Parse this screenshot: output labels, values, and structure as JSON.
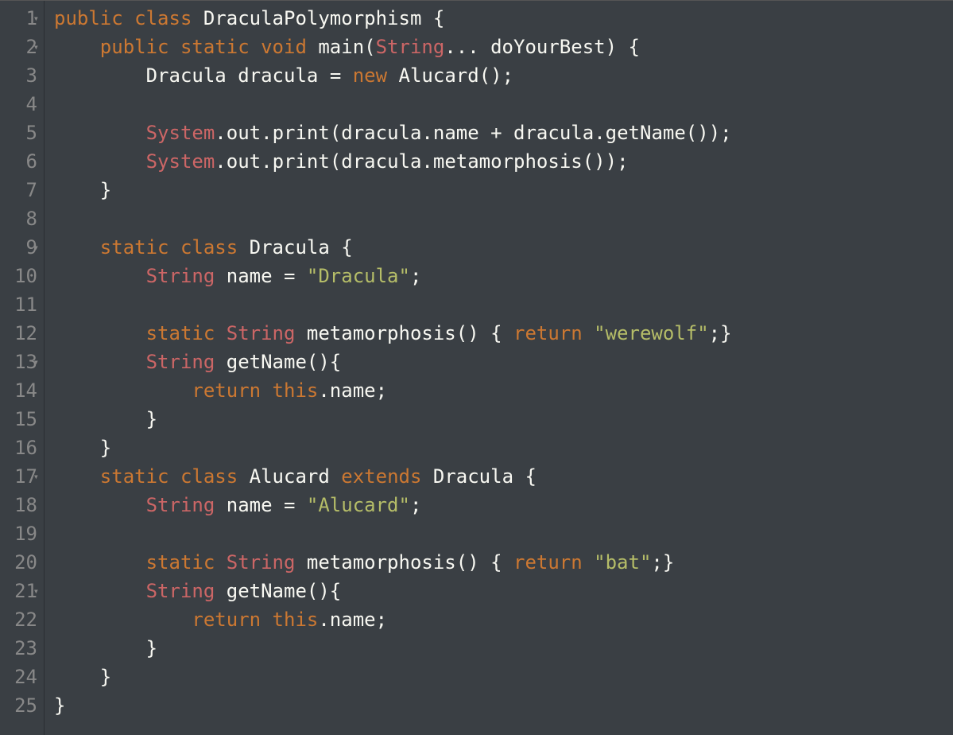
{
  "lineCount": 25,
  "foldLines": [
    1,
    2,
    9,
    13,
    17,
    21
  ],
  "code": {
    "l1": [
      {
        "t": "public",
        "c": "tok-keyword"
      },
      {
        "t": " ",
        "c": ""
      },
      {
        "t": "class",
        "c": "tok-keyword"
      },
      {
        "t": " ",
        "c": ""
      },
      {
        "t": "DraculaPolymorphism",
        "c": "tok-class"
      },
      {
        "t": " {",
        "c": "tok-punct"
      }
    ],
    "l2": [
      {
        "t": "    ",
        "c": ""
      },
      {
        "t": "public",
        "c": "tok-keyword"
      },
      {
        "t": " ",
        "c": ""
      },
      {
        "t": "static",
        "c": "tok-keyword"
      },
      {
        "t": " ",
        "c": ""
      },
      {
        "t": "void",
        "c": "tok-keyword"
      },
      {
        "t": " ",
        "c": ""
      },
      {
        "t": "main",
        "c": "tok-method"
      },
      {
        "t": "(",
        "c": "tok-punct"
      },
      {
        "t": "String",
        "c": "tok-type"
      },
      {
        "t": "... ",
        "c": "tok-punct"
      },
      {
        "t": "doYourBest",
        "c": "tok-param"
      },
      {
        "t": ") {",
        "c": "tok-punct"
      }
    ],
    "l3": [
      {
        "t": "        ",
        "c": ""
      },
      {
        "t": "Dracula",
        "c": "tok-class"
      },
      {
        "t": " ",
        "c": ""
      },
      {
        "t": "dracula",
        "c": "tok-field"
      },
      {
        "t": " ",
        "c": ""
      },
      {
        "t": "=",
        "c": "tok-op"
      },
      {
        "t": " ",
        "c": ""
      },
      {
        "t": "new",
        "c": "tok-keyword"
      },
      {
        "t": " ",
        "c": ""
      },
      {
        "t": "Alucard",
        "c": "tok-class"
      },
      {
        "t": "();",
        "c": "tok-punct"
      }
    ],
    "l4": [],
    "l5": [
      {
        "t": "        ",
        "c": ""
      },
      {
        "t": "System",
        "c": "tok-type"
      },
      {
        "t": ".",
        "c": "tok-punct"
      },
      {
        "t": "out",
        "c": "tok-field"
      },
      {
        "t": ".",
        "c": "tok-punct"
      },
      {
        "t": "print",
        "c": "tok-method"
      },
      {
        "t": "(",
        "c": "tok-punct"
      },
      {
        "t": "dracula",
        "c": "tok-field"
      },
      {
        "t": ".",
        "c": "tok-punct"
      },
      {
        "t": "name",
        "c": "tok-field"
      },
      {
        "t": " ",
        "c": ""
      },
      {
        "t": "+",
        "c": "tok-op"
      },
      {
        "t": " ",
        "c": ""
      },
      {
        "t": "dracula",
        "c": "tok-field"
      },
      {
        "t": ".",
        "c": "tok-punct"
      },
      {
        "t": "getName",
        "c": "tok-method"
      },
      {
        "t": "());",
        "c": "tok-punct"
      }
    ],
    "l6": [
      {
        "t": "        ",
        "c": ""
      },
      {
        "t": "System",
        "c": "tok-type"
      },
      {
        "t": ".",
        "c": "tok-punct"
      },
      {
        "t": "out",
        "c": "tok-field"
      },
      {
        "t": ".",
        "c": "tok-punct"
      },
      {
        "t": "print",
        "c": "tok-method"
      },
      {
        "t": "(",
        "c": "tok-punct"
      },
      {
        "t": "dracula",
        "c": "tok-field"
      },
      {
        "t": ".",
        "c": "tok-punct"
      },
      {
        "t": "metamorphosis",
        "c": "tok-method"
      },
      {
        "t": "());",
        "c": "tok-punct"
      }
    ],
    "l7": [
      {
        "t": "    }",
        "c": "tok-punct"
      }
    ],
    "l8": [],
    "l9": [
      {
        "t": "    ",
        "c": ""
      },
      {
        "t": "static",
        "c": "tok-keyword"
      },
      {
        "t": " ",
        "c": ""
      },
      {
        "t": "class",
        "c": "tok-keyword"
      },
      {
        "t": " ",
        "c": ""
      },
      {
        "t": "Dracula",
        "c": "tok-class"
      },
      {
        "t": " {",
        "c": "tok-punct"
      }
    ],
    "l10": [
      {
        "t": "        ",
        "c": ""
      },
      {
        "t": "String",
        "c": "tok-type"
      },
      {
        "t": " ",
        "c": ""
      },
      {
        "t": "name",
        "c": "tok-field"
      },
      {
        "t": " ",
        "c": ""
      },
      {
        "t": "=",
        "c": "tok-op"
      },
      {
        "t": " ",
        "c": ""
      },
      {
        "t": "\"Dracula\"",
        "c": "tok-string"
      },
      {
        "t": ";",
        "c": "tok-punct"
      }
    ],
    "l11": [],
    "l12": [
      {
        "t": "        ",
        "c": ""
      },
      {
        "t": "static",
        "c": "tok-keyword"
      },
      {
        "t": " ",
        "c": ""
      },
      {
        "t": "String",
        "c": "tok-type"
      },
      {
        "t": " ",
        "c": ""
      },
      {
        "t": "metamorphosis",
        "c": "tok-method"
      },
      {
        "t": "() { ",
        "c": "tok-punct"
      },
      {
        "t": "return",
        "c": "tok-keyword"
      },
      {
        "t": " ",
        "c": ""
      },
      {
        "t": "\"werewolf\"",
        "c": "tok-string"
      },
      {
        "t": ";}",
        "c": "tok-punct"
      }
    ],
    "l13": [
      {
        "t": "        ",
        "c": ""
      },
      {
        "t": "String",
        "c": "tok-type"
      },
      {
        "t": " ",
        "c": ""
      },
      {
        "t": "getName",
        "c": "tok-method"
      },
      {
        "t": "(){",
        "c": "tok-punct"
      }
    ],
    "l14": [
      {
        "t": "            ",
        "c": ""
      },
      {
        "t": "return",
        "c": "tok-keyword"
      },
      {
        "t": " ",
        "c": ""
      },
      {
        "t": "this",
        "c": "tok-this"
      },
      {
        "t": ".",
        "c": "tok-punct"
      },
      {
        "t": "name",
        "c": "tok-field"
      },
      {
        "t": ";",
        "c": "tok-punct"
      }
    ],
    "l15": [
      {
        "t": "        }",
        "c": "tok-punct"
      }
    ],
    "l16": [
      {
        "t": "    }",
        "c": "tok-punct"
      }
    ],
    "l17": [
      {
        "t": "    ",
        "c": ""
      },
      {
        "t": "static",
        "c": "tok-keyword"
      },
      {
        "t": " ",
        "c": ""
      },
      {
        "t": "class",
        "c": "tok-keyword"
      },
      {
        "t": " ",
        "c": ""
      },
      {
        "t": "Alucard",
        "c": "tok-class"
      },
      {
        "t": " ",
        "c": ""
      },
      {
        "t": "extends",
        "c": "tok-keyword"
      },
      {
        "t": " ",
        "c": ""
      },
      {
        "t": "Dracula",
        "c": "tok-class"
      },
      {
        "t": " {",
        "c": "tok-punct"
      }
    ],
    "l18": [
      {
        "t": "        ",
        "c": ""
      },
      {
        "t": "String",
        "c": "tok-type"
      },
      {
        "t": " ",
        "c": ""
      },
      {
        "t": "name",
        "c": "tok-field"
      },
      {
        "t": " ",
        "c": ""
      },
      {
        "t": "=",
        "c": "tok-op"
      },
      {
        "t": " ",
        "c": ""
      },
      {
        "t": "\"Alucard\"",
        "c": "tok-string"
      },
      {
        "t": ";",
        "c": "tok-punct"
      }
    ],
    "l19": [],
    "l20": [
      {
        "t": "        ",
        "c": ""
      },
      {
        "t": "static",
        "c": "tok-keyword"
      },
      {
        "t": " ",
        "c": ""
      },
      {
        "t": "String",
        "c": "tok-type"
      },
      {
        "t": " ",
        "c": ""
      },
      {
        "t": "metamorphosis",
        "c": "tok-method"
      },
      {
        "t": "() { ",
        "c": "tok-punct"
      },
      {
        "t": "return",
        "c": "tok-keyword"
      },
      {
        "t": " ",
        "c": ""
      },
      {
        "t": "\"bat\"",
        "c": "tok-string"
      },
      {
        "t": ";}",
        "c": "tok-punct"
      }
    ],
    "l21": [
      {
        "t": "        ",
        "c": ""
      },
      {
        "t": "String",
        "c": "tok-type"
      },
      {
        "t": " ",
        "c": ""
      },
      {
        "t": "getName",
        "c": "tok-method"
      },
      {
        "t": "(){",
        "c": "tok-punct"
      }
    ],
    "l22": [
      {
        "t": "            ",
        "c": ""
      },
      {
        "t": "return",
        "c": "tok-keyword"
      },
      {
        "t": " ",
        "c": ""
      },
      {
        "t": "this",
        "c": "tok-this"
      },
      {
        "t": ".",
        "c": "tok-punct"
      },
      {
        "t": "name",
        "c": "tok-field"
      },
      {
        "t": ";",
        "c": "tok-punct"
      }
    ],
    "l23": [
      {
        "t": "        }",
        "c": "tok-punct"
      }
    ],
    "l24": [
      {
        "t": "    }",
        "c": "tok-punct"
      }
    ],
    "l25": [
      {
        "t": "}",
        "c": "tok-punct"
      }
    ]
  }
}
